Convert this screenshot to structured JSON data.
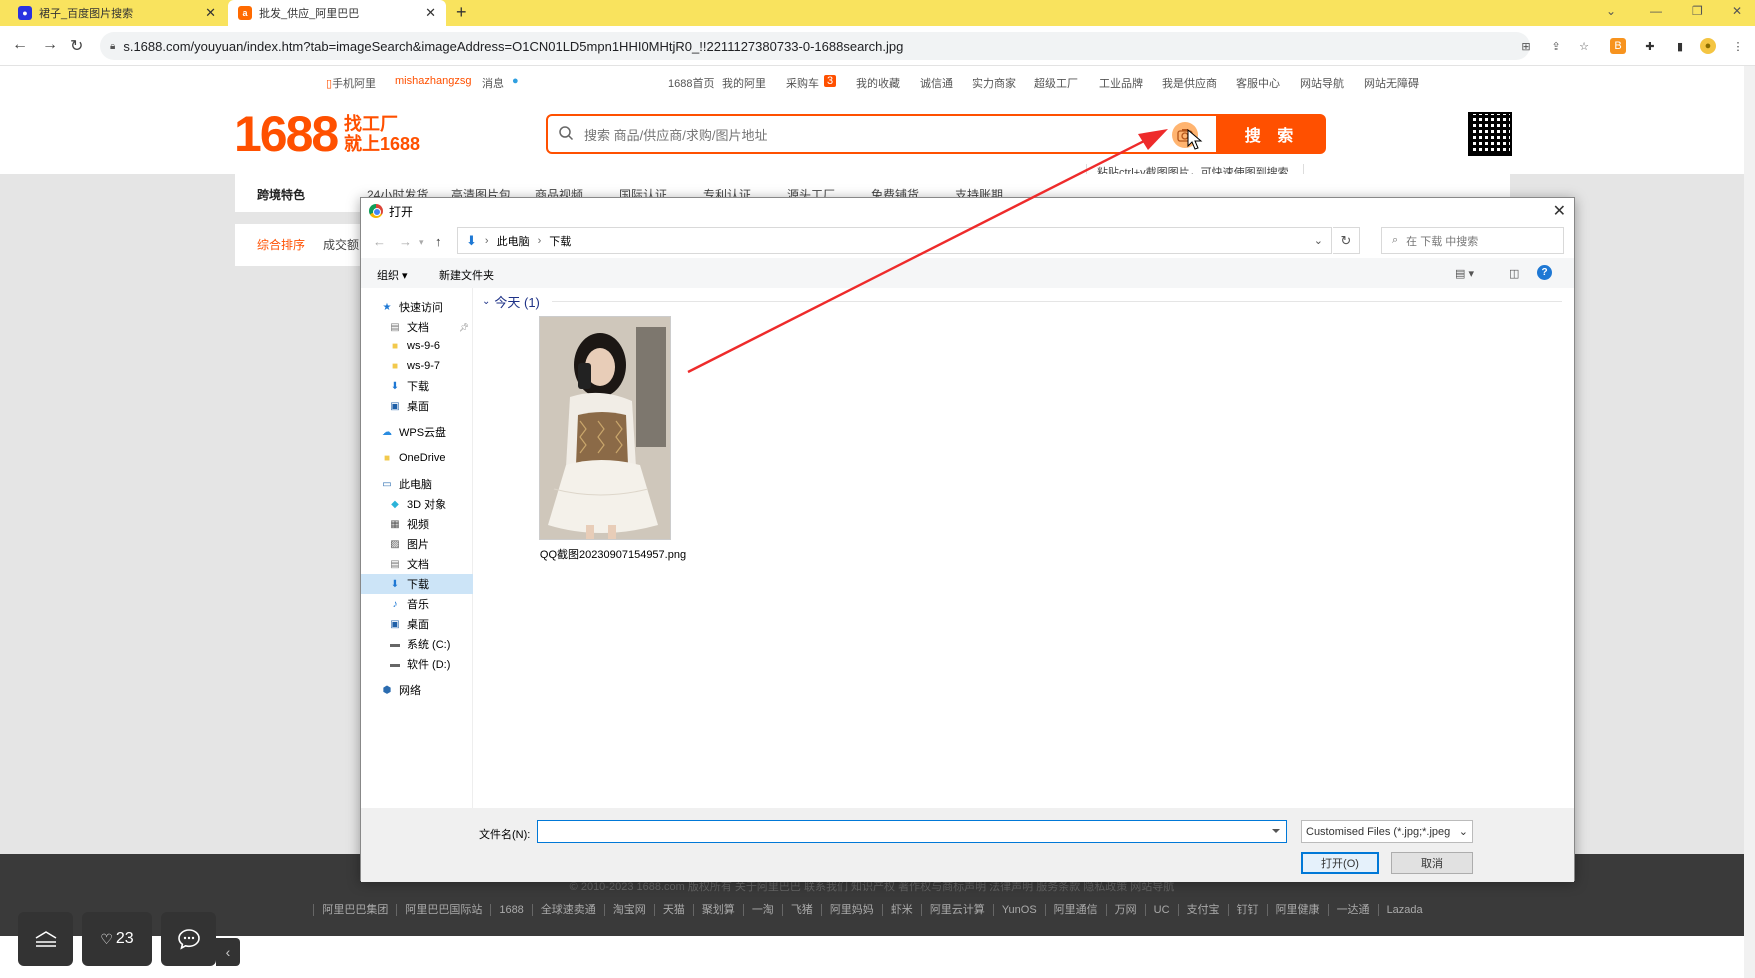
{
  "browser": {
    "tabs": [
      {
        "label": "裙子_百度图片搜索",
        "icon": "baidu-paw-icon"
      },
      {
        "label": "批发_供应_阿里巴巴",
        "icon": "alibaba-icon"
      }
    ],
    "address": "s.1688.com/youyuan/index.htm?tab=imageSearch&imageAddress=O1CN01LD5mpn1HHI0MHtjR0_!!2211127380733-0-1688search.jpg",
    "colors": {
      "tabstrip": "#f9e35e",
      "accent": "#ff5000"
    }
  },
  "topnav": {
    "mobile": "手机阿里",
    "user": "mishazhangzsg",
    "messages": "消息",
    "links": [
      "1688首页",
      "我的阿里",
      "采购车",
      "我的收藏",
      "诚信通",
      "实力商家",
      "超级工厂",
      "工业品牌",
      "我是供应商",
      "客服中心",
      "网站导航",
      "网站无障碍"
    ],
    "cart_count": "3"
  },
  "header": {
    "logo": "1688",
    "slogan_line1": "找工厂",
    "slogan_line2": "就上1688",
    "search_placeholder": "搜索 商品/供应商/求购/图片地址",
    "search_button": "搜 索",
    "hint": "粘贴ctrl+v截图图片，可快速使图到搜索"
  },
  "filters": {
    "row1_label": "跨境特色",
    "row1": [
      "24小时发货",
      "高清图片包",
      "商品视频",
      "国际认证",
      "专利认证",
      "源头工厂",
      "免费铺货",
      "支持账期"
    ],
    "row2": [
      "综合排序",
      "成交额"
    ]
  },
  "footer": {
    "copyright": "© 2010-2023 1688.com 版权所有  关于阿里巴巴  联系我们  知识产权  著作权与商标声明  法律声明  服务条款  隐私政策  网站导航",
    "links": [
      "阿里巴巴集团",
      "阿里巴巴国际站",
      "1688",
      "全球速卖通",
      "淘宝网",
      "天猫",
      "聚划算",
      "一淘",
      "飞猪",
      "阿里妈妈",
      "虾米",
      "阿里云计算",
      "YunOS",
      "阿里通信",
      "万网",
      "UC",
      "支付宝",
      "钉钉",
      "阿里健康",
      "一达通",
      "Lazada"
    ]
  },
  "floating": {
    "like_count": "23"
  },
  "dialog": {
    "title": "打开",
    "breadcrumb": [
      "此电脑",
      "下载"
    ],
    "search_placeholder": "在 下载 中搜索",
    "organize": "组织 ▾",
    "new_folder": "新建文件夹",
    "nav": [
      {
        "label": "快速访问",
        "icon": "star-icon",
        "sub": false
      },
      {
        "label": "文档",
        "icon": "document-icon",
        "sub": true
      },
      {
        "label": "ws-9-6",
        "icon": "folder-icon",
        "sub": true
      },
      {
        "label": "ws-9-7",
        "icon": "folder-icon",
        "sub": true
      },
      {
        "label": "下载",
        "icon": "download-icon",
        "sub": true
      },
      {
        "label": "桌面",
        "icon": "desktop-icon",
        "sub": true
      },
      {
        "label": "WPS云盘",
        "icon": "cloud-icon",
        "sub": false
      },
      {
        "label": "OneDrive",
        "icon": "folder-icon",
        "sub": false
      },
      {
        "label": "此电脑",
        "icon": "computer-icon",
        "sub": false
      },
      {
        "label": "3D 对象",
        "icon": "cube-icon",
        "sub": true
      },
      {
        "label": "视频",
        "icon": "video-icon",
        "sub": true
      },
      {
        "label": "图片",
        "icon": "picture-icon",
        "sub": true
      },
      {
        "label": "文档",
        "icon": "document-icon",
        "sub": true
      },
      {
        "label": "下载",
        "icon": "download-icon",
        "sub": true
      },
      {
        "label": "音乐",
        "icon": "music-icon",
        "sub": true
      },
      {
        "label": "桌面",
        "icon": "desktop-icon",
        "sub": true
      },
      {
        "label": "系统 (C:)",
        "icon": "drive-icon",
        "sub": true
      },
      {
        "label": "软件 (D:)",
        "icon": "drive-icon",
        "sub": true
      },
      {
        "label": "网络",
        "icon": "network-icon",
        "sub": false
      }
    ],
    "selected_nav": "下载",
    "group_header": "今天 (1)",
    "file_name": "QQ截图20230907154957.png",
    "filename_label": "文件名(N):",
    "filename_value": "",
    "filter": "Customised Files (*.jpg;*.jpeg",
    "open_button": "打开(O)",
    "cancel_button": "取消"
  }
}
